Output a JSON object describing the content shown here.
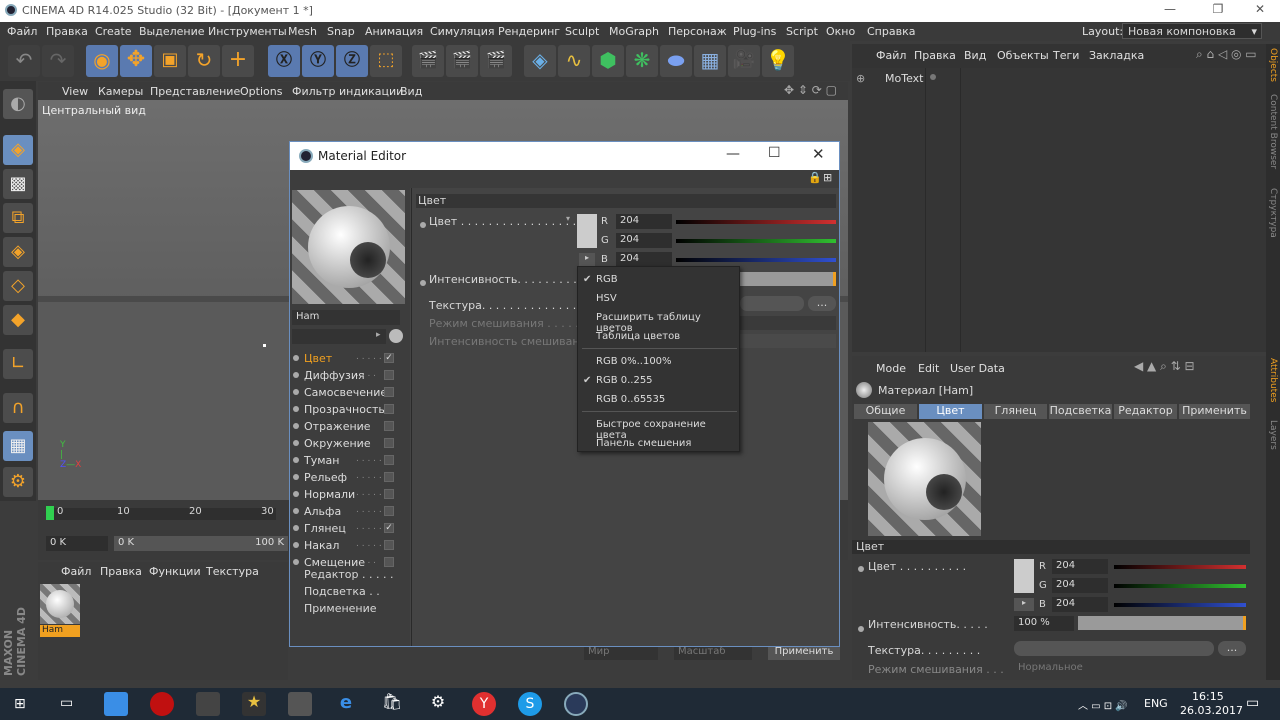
{
  "app": {
    "title": "CINEMA 4D R14.025 Studio (32 Bit) - [Документ 1 *]"
  },
  "menu": [
    "Файл",
    "Правка",
    "Create",
    "Выделение",
    "Инструменты",
    "Mesh",
    "Snap",
    "Анимация",
    "Симуляция",
    "Рендеринг",
    "Sculpt",
    "MoGraph",
    "Персонаж",
    "Plug-ins",
    "Script",
    "Окно",
    "Справка"
  ],
  "layout": {
    "label": "Layout:",
    "value": "Новая компоновка"
  },
  "viewport": {
    "menu": [
      "View",
      "Камеры",
      "Представление",
      "Options",
      "Фильтр индикации",
      "Вид"
    ],
    "label": "Центральный вид"
  },
  "object_panel": {
    "menu": [
      "Файл",
      "Правка",
      "Вид",
      "Объекты",
      "Теги",
      "Закладка"
    ],
    "item": "MoText"
  },
  "side_tabs": [
    "Objects",
    "Content Browser",
    "Структура",
    "Attributes",
    "Layers"
  ],
  "timeline": {
    "ticks": [
      "0",
      "10",
      "20",
      "30"
    ],
    "field_left": "0 K",
    "field_mid": "0 K",
    "field_right": "100 K"
  },
  "material_manager": {
    "menu": [
      "Файл",
      "Правка",
      "Функции",
      "Текстура"
    ],
    "material_name": "Ham"
  },
  "material_editor": {
    "title": "Material Editor",
    "name": "Ham",
    "channels": [
      {
        "label": "Цвет",
        "dots": ". . . . . .",
        "checked": true,
        "active": true
      },
      {
        "label": "Диффузия",
        "dots": ". . . .",
        "checked": false
      },
      {
        "label": "Самосвечение",
        "dots": "",
        "checked": false
      },
      {
        "label": "Прозрачность",
        "dots": "",
        "checked": false
      },
      {
        "label": "Отражение",
        "dots": ". . .",
        "checked": false
      },
      {
        "label": "Окружение",
        "dots": ". . .",
        "checked": false
      },
      {
        "label": "Туман",
        "dots": ". . . . . . .",
        "checked": false
      },
      {
        "label": "Рельеф",
        "dots": ". . . . . . .",
        "checked": false
      },
      {
        "label": "Нормали",
        "dots": ". . . . .",
        "checked": false
      },
      {
        "label": "Альфа",
        "dots": ". . . . . . .",
        "checked": false
      },
      {
        "label": "Глянец",
        "dots": ". . . . . .",
        "checked": true
      },
      {
        "label": "Накал",
        "dots": ". . . . . . .",
        "checked": false
      },
      {
        "label": "Смещение",
        "dots": ". . . .",
        "checked": false
      }
    ],
    "extra": [
      "Редактор . . . . .",
      "Подсветка . .",
      "Применение"
    ],
    "section": "Цвет",
    "color_label": "Цвет . . . . . . . . . . . . . . . . .",
    "intensity_label": "Интенсивность. . . . . . . . . . .",
    "texture_label": "Текстура. . . . . . . . . . . . . . .",
    "blend_label": "Режим смешивания . . . . . . . .",
    "blend_strength_label": "Интенсивность смешивания . .",
    "rgb": {
      "r": "204",
      "g": "204",
      "b": "204"
    },
    "texture_btn": "..."
  },
  "dropdown": [
    {
      "label": "RGB",
      "checked": true
    },
    {
      "label": "HSV",
      "checked": false
    },
    {
      "label": "Расширить таблицу цветов",
      "checked": false
    },
    {
      "label": "Таблица цветов",
      "checked": false
    },
    {
      "label": "RGB 0%..100%",
      "checked": false
    },
    {
      "label": "RGB 0..255",
      "checked": true
    },
    {
      "label": "RGB 0..65535",
      "checked": false
    },
    {
      "label": "Быстрое сохранение цвета",
      "checked": false
    },
    {
      "label": "Панель смешения",
      "checked": false
    }
  ],
  "behind_editor": {
    "world": "Мир",
    "scale": "Масштаб",
    "apply": "Применить"
  },
  "attributes": {
    "menu": [
      "Mode",
      "Edit",
      "User Data"
    ],
    "title": "Материал [Ham]",
    "tabs": [
      "Общие",
      "Цвет",
      "Глянец",
      "Подсветка",
      "Редактор",
      "Применить"
    ],
    "active_tab": "Цвет",
    "section": "Цвет",
    "color_label": "Цвет . . . . . . . . . .",
    "rgb": {
      "r": "204",
      "g": "204",
      "b": "204"
    },
    "intensity_label": "Интенсивность. . . . .",
    "intensity_value": "100 %",
    "texture_label": "Текстура. . . . . . . . .",
    "blend_label": "Режим смешивания . . .",
    "blend_value": "Нормальное",
    "texture_btn": "..."
  },
  "brand": {
    "line1": "MAXON",
    "line2": "CINEMA 4D"
  },
  "taskbar": {
    "lang": "ENG",
    "time": "16:15",
    "date": "26.03.2017"
  },
  "colors": {
    "accent": "#6a8fc0",
    "active_channel": "#f0a020",
    "red": "#d23030",
    "green": "#30c030",
    "blue": "#3050d0"
  }
}
